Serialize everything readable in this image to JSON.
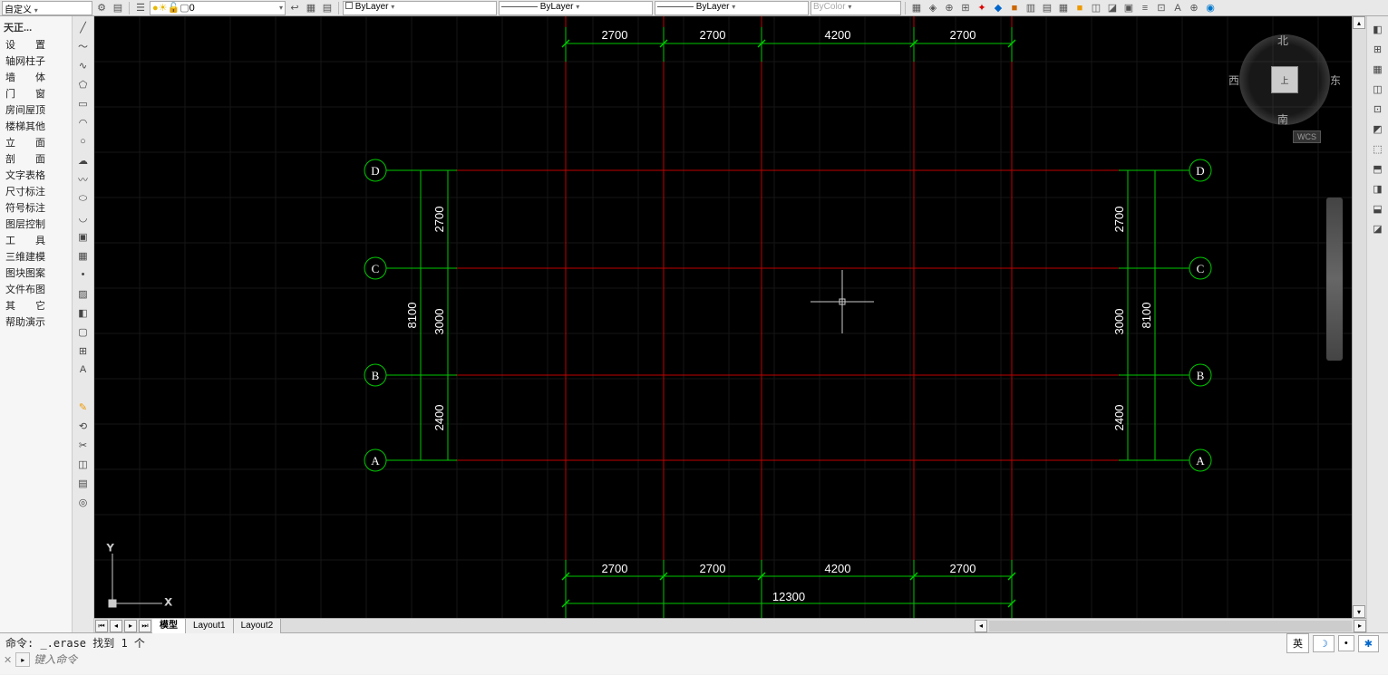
{
  "toolbar": {
    "custom_label": "自定义",
    "layer_name": "0",
    "bylayer": "ByLayer",
    "bycolor": "ByColor",
    "swatch_white": "□",
    "line_style": "———— ByLayer",
    "lineweight": "———— ByLayer"
  },
  "sidebar": {
    "title": "天正...",
    "items": [
      {
        "label": "设　　置"
      },
      {
        "label": "轴网柱子"
      },
      {
        "label": "墙　　体"
      },
      {
        "label": "门　　窗"
      },
      {
        "label": "房间屋顶"
      },
      {
        "label": "楼梯其他"
      },
      {
        "label": "立　　面"
      },
      {
        "label": "剖　　面"
      },
      {
        "label": "文字表格"
      },
      {
        "label": "尺寸标注"
      },
      {
        "label": "符号标注"
      },
      {
        "label": "图层控制"
      },
      {
        "label": "工　　具"
      },
      {
        "label": "三维建模"
      },
      {
        "label": "图块图案"
      },
      {
        "label": "文件布图"
      },
      {
        "label": "其　　它"
      },
      {
        "label": "帮助演示"
      }
    ]
  },
  "tabs": {
    "model": "模型",
    "layout1": "Layout1",
    "layout2": "Layout2"
  },
  "command": {
    "history": "命令: _.erase 找到 1 个",
    "placeholder": "键入命令"
  },
  "navcube": {
    "top": "上",
    "n": "北",
    "s": "南",
    "e": "东",
    "w": "西",
    "wcs": "WCS"
  },
  "status": {
    "ime": "英"
  },
  "ucs": {
    "x": "X",
    "y": "Y"
  },
  "drawing": {
    "axis_labels": [
      "A",
      "B",
      "C",
      "D"
    ],
    "h_dims_top": [
      "2700",
      "2700",
      "4200",
      "2700"
    ],
    "h_dims_bot": [
      "2700",
      "2700",
      "4200",
      "2700"
    ],
    "h_total": "12300",
    "v_dims_left_inner": [
      "2400",
      "3000",
      "2700"
    ],
    "v_total_left": "8100",
    "v_dims_right_inner": [
      "2400",
      "3000",
      "2700"
    ],
    "v_total_right": "8100"
  },
  "right_icons": [
    "◧",
    "⊞",
    "▦",
    "◫",
    "⊡",
    "◩",
    "⬚",
    "⬒",
    "◨",
    "⬓",
    "◪"
  ]
}
